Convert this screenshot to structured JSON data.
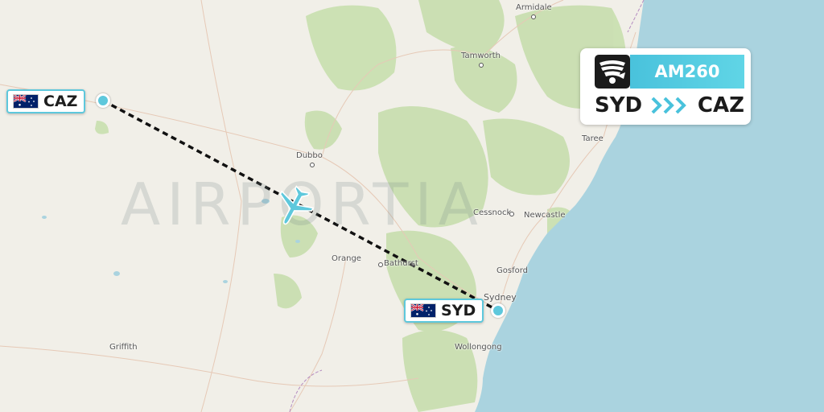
{
  "map": {
    "watermark": "AIRPORTIA",
    "cities": [
      {
        "name": "Armidale",
        "key": "armidale"
      },
      {
        "name": "Tamworth",
        "key": "tamworth"
      },
      {
        "name": "Taree",
        "key": "taree"
      },
      {
        "name": "Dubbo",
        "key": "dubbo"
      },
      {
        "name": "Cessnock",
        "key": "cessnock"
      },
      {
        "name": "Newcastle",
        "key": "newcastle"
      },
      {
        "name": "Orange",
        "key": "orange"
      },
      {
        "name": "Bathurst",
        "key": "bathurst"
      },
      {
        "name": "Gosford",
        "key": "gosford"
      },
      {
        "name": "Sydney",
        "key": "sydney"
      },
      {
        "name": "Wollongong",
        "key": "wollongong"
      },
      {
        "name": "Griffith",
        "key": "griffith"
      }
    ],
    "colors": {
      "ocean": "#aad3df",
      "land": "#f1efe8",
      "forest": "#c9dfb1",
      "route": "#111111",
      "accent": "#5ec8dc"
    }
  },
  "origin": {
    "code": "SYD",
    "country_flag": "australia-flag-icon"
  },
  "destination": {
    "code": "CAZ",
    "country_flag": "australia-flag-icon"
  },
  "flight": {
    "number": "AM260",
    "from": "SYD",
    "to": "CAZ",
    "airline_logo": "aeromexico-eagle-logo",
    "route_icon": "triple-chevron-right-icon"
  }
}
